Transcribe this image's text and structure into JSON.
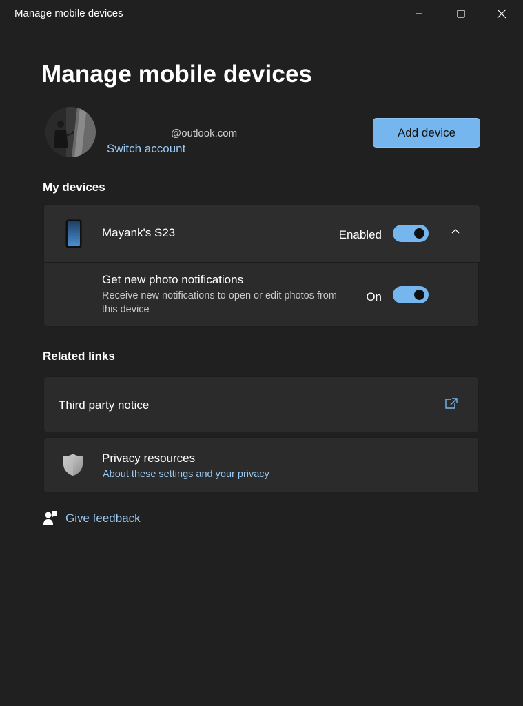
{
  "window": {
    "title": "Manage mobile devices",
    "minimize_icon": "minimize-icon",
    "maximize_icon": "maximize-icon",
    "close_icon": "close-icon"
  },
  "page": {
    "title": "Manage mobile devices"
  },
  "account": {
    "email": "@outlook.com",
    "switch_label": "Switch account",
    "add_device_label": "Add device"
  },
  "my_devices": {
    "heading": "My devices",
    "device": {
      "icon": "phone-icon",
      "name": "Mayank's S23",
      "status_label": "Enabled",
      "enabled": true,
      "expanded": true
    },
    "photo_notifications": {
      "title": "Get new photo notifications",
      "description": "Receive new notifications to open or edit photos from this device",
      "status_label": "On",
      "enabled": true
    }
  },
  "related_links": {
    "heading": "Related links",
    "third_party": {
      "label": "Third party notice",
      "icon": "external-link-icon"
    },
    "privacy": {
      "icon": "shield-icon",
      "title": "Privacy resources",
      "link": "About these settings and your privacy"
    }
  },
  "feedback": {
    "icon": "feedback-icon",
    "label": "Give feedback"
  },
  "colors": {
    "background": "#202020",
    "card": "#2b2b2b",
    "accent": "#76b6ef",
    "link": "#99c8f0"
  }
}
